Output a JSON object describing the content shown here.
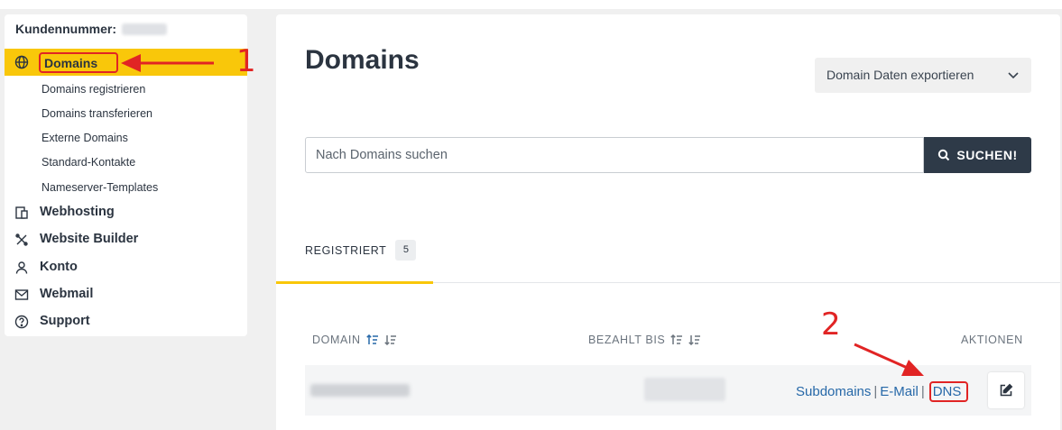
{
  "sidebar": {
    "customer_label": "Kundennummer:",
    "active_item": {
      "label": "Domains",
      "icon": "globe-icon"
    },
    "sub_items": [
      {
        "label": "Domains registrieren"
      },
      {
        "label": "Domains transferieren"
      },
      {
        "label": "Externe Domains"
      },
      {
        "label": "Standard-Kontakte"
      },
      {
        "label": "Nameserver-Templates"
      }
    ],
    "items": [
      {
        "label": "Webhosting",
        "icon": "webhosting-icon"
      },
      {
        "label": "Website Builder",
        "icon": "tools-icon"
      },
      {
        "label": "Konto",
        "icon": "user-icon"
      },
      {
        "label": "Webmail",
        "icon": "mail-icon"
      },
      {
        "label": "Support",
        "icon": "help-icon"
      }
    ]
  },
  "main": {
    "title": "Domains",
    "export_label": "Domain Daten exportieren",
    "search": {
      "placeholder": "Nach Domains suchen",
      "button_label": "SUCHEN!"
    },
    "tab": {
      "label": "REGISTRIERT",
      "count": "5"
    },
    "table": {
      "headers": {
        "domain": "DOMAIN",
        "paid_until": "BEZAHLT BIS",
        "actions": "AKTIONEN"
      },
      "row": {
        "links": {
          "subdomains": "Subdomains",
          "separator": "|",
          "email": "E-Mail",
          "dns": "DNS"
        }
      }
    }
  },
  "annotations": {
    "step1": "1",
    "step2": "2",
    "color": "#e12424"
  },
  "colors": {
    "accent": "#f9c70a",
    "button_dark": "#2e3a48",
    "link": "#2668a8"
  }
}
